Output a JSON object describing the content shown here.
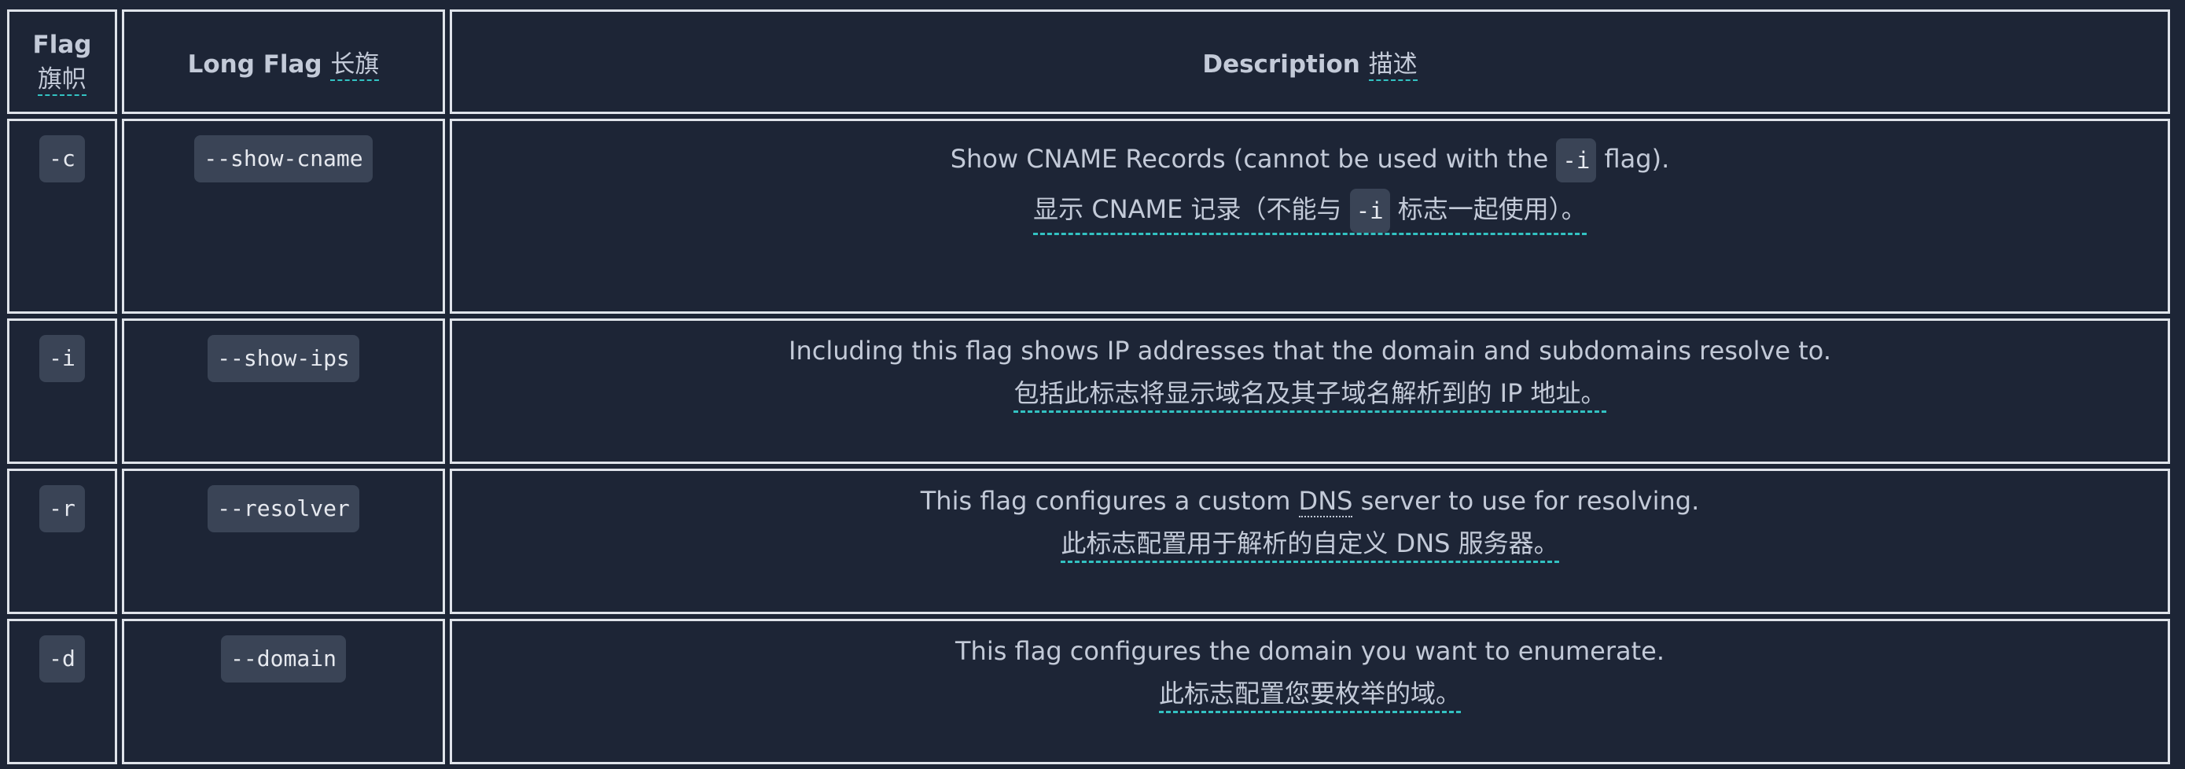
{
  "headers": {
    "flag_en": "Flag",
    "flag_zh": "旗帜",
    "long_en": "Long Flag",
    "long_zh": "长旗",
    "desc_en": "Description",
    "desc_zh": "描述"
  },
  "rows": [
    {
      "flag": "-c",
      "long": "--show-cname",
      "desc_en_before": "Show CNAME Records (cannot be used with the",
      "desc_en_code": "-i",
      "desc_en_after": "flag).",
      "desc_zh_before": "显示 CNAME 记录（不能与",
      "desc_zh_code": "-i",
      "desc_zh_after": "标志一起使用）。"
    },
    {
      "flag": "-i",
      "long": "--show-ips",
      "desc_en": "Including this flag shows IP addresses that the domain and subdomains resolve to.",
      "desc_zh": "包括此标志将显示域名及其子域名解析到的 IP 地址。"
    },
    {
      "flag": "-r",
      "long": "--resolver",
      "desc_en_before": "This flag configures a custom",
      "desc_en_abbr": "DNS",
      "desc_en_after": "server to use for resolving.",
      "desc_zh": "此标志配置用于解析的自定义 DNS 服务器。"
    },
    {
      "flag": "-d",
      "long": "--domain",
      "desc_en": "This flag configures the domain you want to enumerate.",
      "desc_zh": "此标志配置您要枚举的域。"
    }
  ]
}
